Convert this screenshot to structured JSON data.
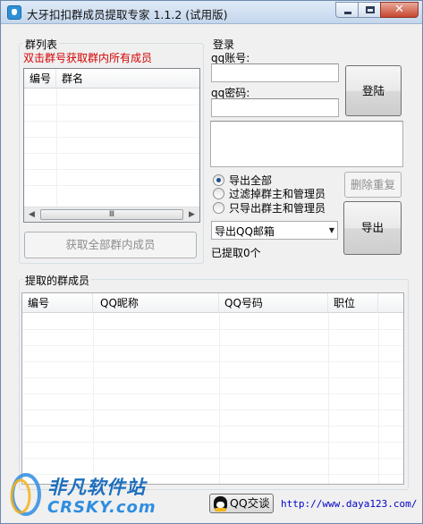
{
  "window": {
    "title": "大牙扣扣群成员提取专家 1.1.2 (试用版)",
    "close_glyph": "✕"
  },
  "group_list": {
    "label": "群列表",
    "hint": "双击群号获取群内所有成员",
    "columns": [
      "编号",
      "群名"
    ],
    "scroll_left": "◀",
    "scroll_right": "▶",
    "scroll_grip": "Ⅲ",
    "fetch_button": "获取全部群内成员"
  },
  "login": {
    "label": "登录",
    "account_label": "qq账号:",
    "account_value": "",
    "password_label": "qq密码:",
    "password_value": "",
    "login_button": "登陆",
    "message_value": ""
  },
  "export_options": {
    "radios": [
      {
        "label": "导出全部",
        "checked": true
      },
      {
        "label": "过滤掉群主和管理员",
        "checked": false
      },
      {
        "label": "只导出群主和管理员",
        "checked": false
      }
    ],
    "dedupe_button": "删除重复",
    "format_select": "导出QQ邮箱",
    "select_arrow": "▼",
    "export_button": "导出",
    "extracted_count": "已提取0个"
  },
  "members": {
    "label": "提取的群成员",
    "columns": [
      "编号",
      "QQ昵称",
      "QQ号码",
      "职位"
    ]
  },
  "footer": {
    "qq_button": "QQ交谈",
    "url": "http://www.daya123.com/"
  },
  "watermark": {
    "line1": "非凡软件站",
    "line2": "CRSKY.com"
  }
}
